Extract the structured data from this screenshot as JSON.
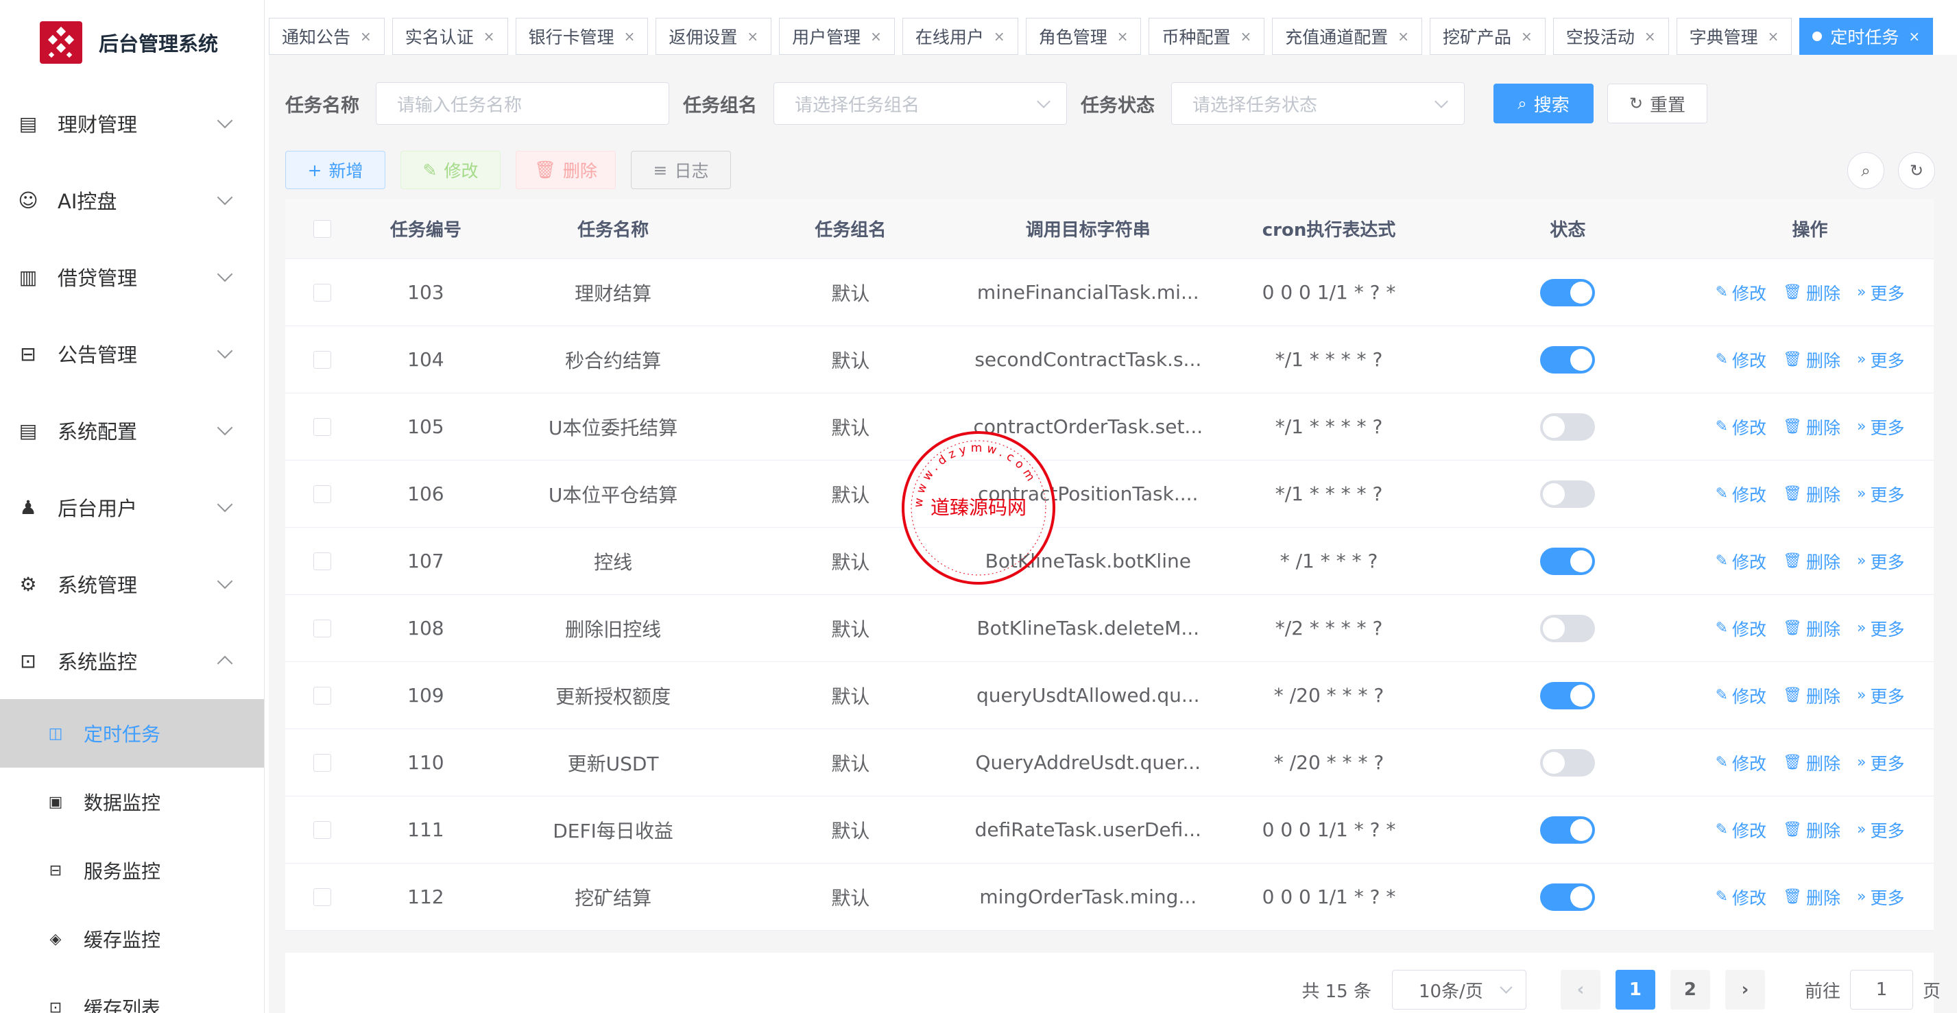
{
  "app": {
    "title": "后台管理系统"
  },
  "sidebar": {
    "items": [
      {
        "label": "理财管理",
        "icon": "document-icon",
        "glyph": "▤"
      },
      {
        "label": "AI控盘",
        "icon": "robot-icon",
        "glyph": "☺"
      },
      {
        "label": "借贷管理",
        "icon": "book-icon",
        "glyph": "▥"
      },
      {
        "label": "公告管理",
        "icon": "open-book-icon",
        "glyph": "⊟"
      },
      {
        "label": "系统配置",
        "icon": "document-icon",
        "glyph": "▤"
      },
      {
        "label": "后台用户",
        "icon": "users-icon",
        "glyph": "♟"
      },
      {
        "label": "系统管理",
        "icon": "gear-icon",
        "glyph": "⚙"
      },
      {
        "label": "系统监控",
        "icon": "monitor-icon",
        "glyph": "⊡"
      }
    ],
    "subitems": [
      {
        "label": "定时任务",
        "icon": "job-icon",
        "glyph": "◫",
        "active": true
      },
      {
        "label": "数据监控",
        "icon": "chart-icon",
        "glyph": "▣"
      },
      {
        "label": "服务监控",
        "icon": "server-icon",
        "glyph": "⊟"
      },
      {
        "label": "缓存监控",
        "icon": "redis-icon",
        "glyph": "◈"
      },
      {
        "label": "缓存列表",
        "icon": "list-icon",
        "glyph": "⊡"
      }
    ]
  },
  "tags": [
    {
      "label": "通知公告"
    },
    {
      "label": "实名认证"
    },
    {
      "label": "银行卡管理"
    },
    {
      "label": "返佣设置"
    },
    {
      "label": "用户管理"
    },
    {
      "label": "在线用户"
    },
    {
      "label": "角色管理"
    },
    {
      "label": "币种配置"
    },
    {
      "label": "充值通道配置"
    },
    {
      "label": "挖矿产品"
    },
    {
      "label": "空投活动"
    },
    {
      "label": "字典管理"
    },
    {
      "label": "定时任务",
      "active": true
    }
  ],
  "search": {
    "job_name_label": "任务名称",
    "job_name_placeholder": "请输入任务名称",
    "job_group_label": "任务组名",
    "job_group_placeholder": "请选择任务组名",
    "status_label": "任务状态",
    "status_placeholder": "请选择任务状态",
    "search_btn": "搜索",
    "reset_btn": "重置"
  },
  "actions": {
    "add": "新增",
    "edit": "修改",
    "delete": "删除",
    "log": "日志"
  },
  "table": {
    "headers": {
      "id": "任务编号",
      "name": "任务名称",
      "group": "任务组名",
      "target": "调用目标字符串",
      "cron": "cron执行表达式",
      "status": "状态",
      "ops": "操作"
    },
    "rows": [
      {
        "id": "103",
        "name": "理财结算",
        "group": "默认",
        "target": "mineFinancialTask.mi...",
        "cron": "0 0 0 1/1 * ? *",
        "on": true
      },
      {
        "id": "104",
        "name": "秒合约结算",
        "group": "默认",
        "target": "secondContractTask.s...",
        "cron": "*/1 * * * * ?",
        "on": true
      },
      {
        "id": "105",
        "name": "U本位委托结算",
        "group": "默认",
        "target": "contractOrderTask.set...",
        "cron": "*/1 * * * * ?",
        "on": false
      },
      {
        "id": "106",
        "name": "U本位平仓结算",
        "group": "默认",
        "target": "contractPositionTask....",
        "cron": "*/1 * * * * ?",
        "on": false
      },
      {
        "id": "107",
        "name": "控线",
        "group": "默认",
        "target": "BotKlineTask.botKline",
        "cron": "* /1 * * * ?",
        "on": true
      },
      {
        "id": "108",
        "name": "删除旧控线",
        "group": "默认",
        "target": "BotKlineTask.deleteM...",
        "cron": "*/2 * * * * ?",
        "on": false
      },
      {
        "id": "109",
        "name": "更新授权额度",
        "group": "默认",
        "target": "queryUsdtAllowed.qu...",
        "cron": "* /20 * * * ?",
        "on": true
      },
      {
        "id": "110",
        "name": "更新USDT",
        "group": "默认",
        "target": "QueryAddreUsdt.quer...",
        "cron": "* /20 * * * ?",
        "on": false
      },
      {
        "id": "111",
        "name": "DEFI每日收益",
        "group": "默认",
        "target": "defiRateTask.userDefi...",
        "cron": "0 0 0 1/1 * ? *",
        "on": true
      },
      {
        "id": "112",
        "name": "挖矿结算",
        "group": "默认",
        "target": "mingOrderTask.ming...",
        "cron": "0 0 0 1/1 * ? *",
        "on": true
      }
    ],
    "ops": {
      "edit": "修改",
      "delete": "删除",
      "more": "更多"
    }
  },
  "pagination": {
    "total": "共 15 条",
    "page_size": "10条/页",
    "pages": [
      "1",
      "2"
    ],
    "current": "1",
    "goto_prefix": "前往",
    "goto_value": "1",
    "goto_suffix": "页"
  },
  "watermark": {
    "text": "道臻源码网",
    "ring": "www.dzymw.com"
  },
  "colors": {
    "primary": "#409eff",
    "brand": "#c8102e",
    "success_light": "#a4da89",
    "danger_light": "#f9a7a7"
  }
}
